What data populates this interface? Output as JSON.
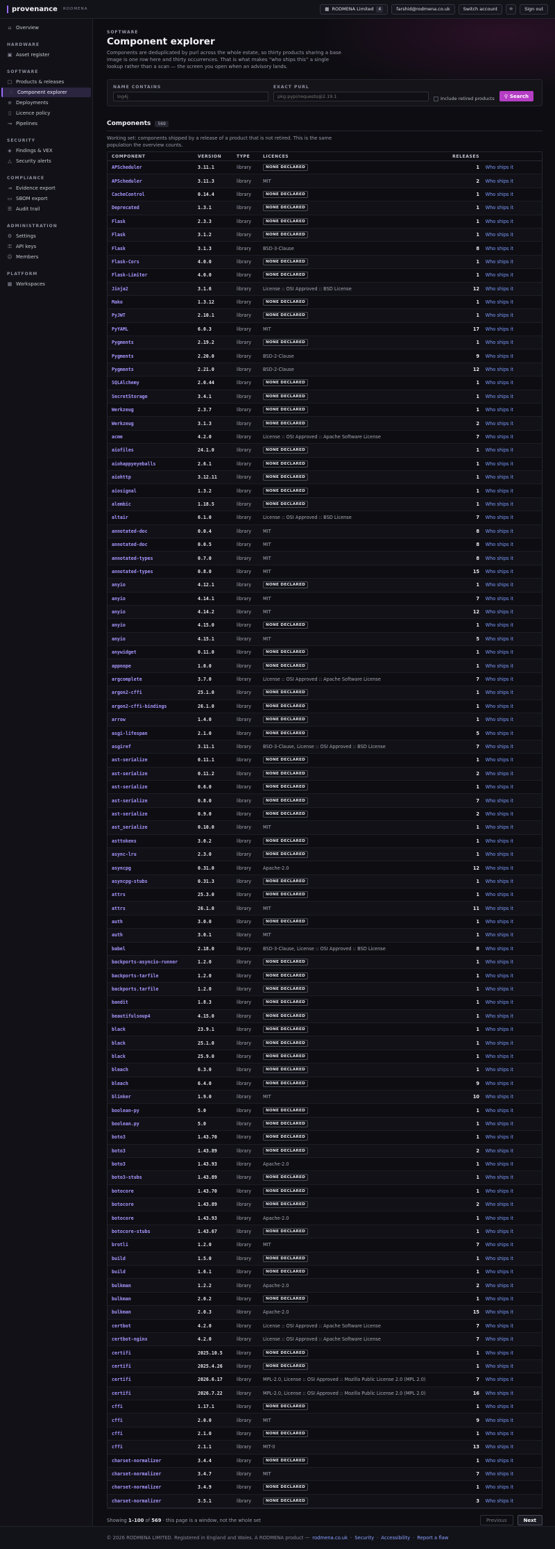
{
  "header": {
    "brand": "provenance",
    "brand_sub": "RODMENA",
    "org_name": "RODMENA Limited",
    "org_count": "4",
    "email": "farshid@rodmena.co.uk",
    "switch_label": "Switch account",
    "settings_icon": "sun-icon",
    "signout_label": "Sign out"
  },
  "sidebar": {
    "top": [
      {
        "label": "Overview",
        "icon": "home-icon"
      }
    ],
    "groups": [
      {
        "heading": "HARDWARE",
        "items": [
          {
            "label": "Asset register",
            "icon": "chip-icon"
          }
        ]
      },
      {
        "heading": "SOFTWARE",
        "items": [
          {
            "label": "Products & releases",
            "icon": "box-icon"
          },
          {
            "label": "Component explorer",
            "icon": "tree-icon",
            "active": true
          },
          {
            "label": "Deployments",
            "icon": "server-icon"
          },
          {
            "label": "Licence policy",
            "icon": "doc-icon"
          },
          {
            "label": "Pipelines",
            "icon": "pipeline-icon"
          }
        ]
      },
      {
        "heading": "SECURITY",
        "items": [
          {
            "label": "Findings & VEX",
            "icon": "shield-icon"
          },
          {
            "label": "Security alerts",
            "icon": "alert-icon"
          }
        ]
      },
      {
        "heading": "COMPLIANCE",
        "items": [
          {
            "label": "Evidence export",
            "icon": "export-icon"
          },
          {
            "label": "SBOM export",
            "icon": "file-icon"
          },
          {
            "label": "Audit trail",
            "icon": "list-icon"
          }
        ]
      },
      {
        "heading": "ADMINISTRATION",
        "items": [
          {
            "label": "Settings",
            "icon": "gear-icon"
          },
          {
            "label": "API keys",
            "icon": "key-icon"
          },
          {
            "label": "Members",
            "icon": "users-icon"
          }
        ]
      },
      {
        "heading": "PLATFORM",
        "items": [
          {
            "label": "Workspaces",
            "icon": "grid-icon"
          }
        ]
      }
    ]
  },
  "page": {
    "eyebrow": "SOFTWARE",
    "title": "Component explorer",
    "intro": "Components are deduplicated by purl across the whole estate, so thirty products sharing a base image is one row here and thirty occurrences. That is what makes “who ships this” a single lookup rather than a scan — the screen you open when an advisory lands."
  },
  "filters": {
    "name_label": "NAME CONTAINS",
    "name_placeholder": "log4j",
    "purl_label": "EXACT PURL",
    "purl_placeholder": "pkg:pypi/requests@2.19.1",
    "retired_label": "Include retired products",
    "search_label": "Search"
  },
  "components": {
    "title": "Components",
    "count": "569",
    "working_set": "Working set: components shipped by a release of a product that is not retired. This is the same population the overview counts.",
    "columns": [
      "COMPONENT",
      "VERSION",
      "TYPE",
      "LICENCES",
      "RELEASES",
      ""
    ],
    "none_declared": "NONE DECLARED",
    "action_label": "Who ships it",
    "rows": [
      [
        "APScheduler",
        "3.11.1",
        "library",
        "",
        1
      ],
      [
        "APScheduler",
        "3.11.3",
        "library",
        "MIT",
        2
      ],
      [
        "CacheControl",
        "0.14.4",
        "library",
        "",
        1
      ],
      [
        "Deprecated",
        "1.3.1",
        "library",
        "",
        1
      ],
      [
        "Flask",
        "2.3.3",
        "library",
        "",
        1
      ],
      [
        "Flask",
        "3.1.2",
        "library",
        "",
        1
      ],
      [
        "Flask",
        "3.1.3",
        "library",
        "BSD-3-Clause",
        8
      ],
      [
        "Flask-Cors",
        "4.0.0",
        "library",
        "",
        1
      ],
      [
        "Flask-Limiter",
        "4.0.0",
        "library",
        "",
        1
      ],
      [
        "Jinja2",
        "3.1.6",
        "library",
        "License :: OSI Approved :: BSD License",
        12
      ],
      [
        "Mako",
        "1.3.12",
        "library",
        "",
        1
      ],
      [
        "PyJWT",
        "2.10.1",
        "library",
        "",
        1
      ],
      [
        "PyYAML",
        "6.0.3",
        "library",
        "MIT",
        17
      ],
      [
        "Pygments",
        "2.19.2",
        "library",
        "",
        1
      ],
      [
        "Pygments",
        "2.20.0",
        "library",
        "BSD-2-Clause",
        9
      ],
      [
        "Pygments",
        "2.21.0",
        "library",
        "BSD-2-Clause",
        12
      ],
      [
        "SQLAlchemy",
        "2.0.44",
        "library",
        "",
        1
      ],
      [
        "SecretStorage",
        "3.4.1",
        "library",
        "",
        1
      ],
      [
        "Werkzeug",
        "2.3.7",
        "library",
        "",
        1
      ],
      [
        "Werkzeug",
        "3.1.3",
        "library",
        "",
        2
      ],
      [
        "acme",
        "4.2.0",
        "library",
        "License :: OSI Approved :: Apache Software License",
        7
      ],
      [
        "aiofiles",
        "24.1.0",
        "library",
        "",
        1
      ],
      [
        "aiohappyeyeballs",
        "2.6.1",
        "library",
        "",
        1
      ],
      [
        "aiohttp",
        "3.12.11",
        "library",
        "",
        1
      ],
      [
        "aiosignal",
        "1.3.2",
        "library",
        "",
        1
      ],
      [
        "alembic",
        "1.18.5",
        "library",
        "",
        1
      ],
      [
        "altair",
        "6.1.0",
        "library",
        "License :: OSI Approved :: BSD License",
        7
      ],
      [
        "annotated-doc",
        "0.0.4",
        "library",
        "MIT",
        8
      ],
      [
        "annotated-doc",
        "0.0.5",
        "library",
        "MIT",
        8
      ],
      [
        "annotated-types",
        "0.7.0",
        "library",
        "MIT",
        8
      ],
      [
        "annotated-types",
        "0.8.0",
        "library",
        "MIT",
        15
      ],
      [
        "anyio",
        "4.12.1",
        "library",
        "",
        1
      ],
      [
        "anyio",
        "4.14.1",
        "library",
        "MIT",
        7
      ],
      [
        "anyio",
        "4.14.2",
        "library",
        "MIT",
        12
      ],
      [
        "anyio",
        "4.15.0",
        "library",
        "",
        1
      ],
      [
        "anyio",
        "4.15.1",
        "library",
        "MIT",
        5
      ],
      [
        "anywidget",
        "0.11.0",
        "library",
        "",
        1
      ],
      [
        "appnope",
        "1.0.0",
        "library",
        "",
        1
      ],
      [
        "argcomplete",
        "3.7.0",
        "library",
        "License :: OSI Approved :: Apache Software License",
        7
      ],
      [
        "argon2-cffi",
        "25.1.0",
        "library",
        "",
        1
      ],
      [
        "argon2-cffi-bindings",
        "26.1.0",
        "library",
        "",
        1
      ],
      [
        "arrow",
        "1.4.0",
        "library",
        "",
        1
      ],
      [
        "asgi-lifespan",
        "2.1.0",
        "library",
        "",
        5
      ],
      [
        "asgiref",
        "3.11.1",
        "library",
        "BSD-3-Clause, License :: OSI Approved :: BSD License",
        7
      ],
      [
        "ast-serialize",
        "0.11.1",
        "library",
        "",
        1
      ],
      [
        "ast-serialize",
        "0.11.2",
        "library",
        "",
        2
      ],
      [
        "ast-serialize",
        "0.6.0",
        "library",
        "",
        1
      ],
      [
        "ast-serialize",
        "0.8.0",
        "library",
        "",
        7
      ],
      [
        "ast-serialize",
        "0.9.0",
        "library",
        "",
        2
      ],
      [
        "ast_serialize",
        "0.10.0",
        "library",
        "MIT",
        1
      ],
      [
        "asttokens",
        "3.0.2",
        "library",
        "",
        1
      ],
      [
        "async-lru",
        "2.3.0",
        "library",
        "",
        1
      ],
      [
        "asyncpg",
        "0.31.0",
        "library",
        "Apache-2.0",
        12
      ],
      [
        "asyncpg-stubs",
        "0.31.3",
        "library",
        "",
        1
      ],
      [
        "attrs",
        "25.3.0",
        "library",
        "",
        1
      ],
      [
        "attrs",
        "26.1.0",
        "library",
        "MIT",
        11
      ],
      [
        "auth",
        "3.0.0",
        "library",
        "",
        1
      ],
      [
        "auth",
        "3.0.1",
        "library",
        "MIT",
        1
      ],
      [
        "babel",
        "2.18.0",
        "library",
        "BSD-3-Clause, License :: OSI Approved :: BSD License",
        8
      ],
      [
        "backports-asyncio-runner",
        "1.2.0",
        "library",
        "",
        1
      ],
      [
        "backports-tarfile",
        "1.2.0",
        "library",
        "",
        1
      ],
      [
        "backports.tarfile",
        "1.2.0",
        "library",
        "",
        1
      ],
      [
        "bandit",
        "1.8.3",
        "library",
        "",
        1
      ],
      [
        "beautifulsoup4",
        "4.15.0",
        "library",
        "",
        1
      ],
      [
        "black",
        "23.9.1",
        "library",
        "",
        1
      ],
      [
        "black",
        "25.1.0",
        "library",
        "",
        1
      ],
      [
        "black",
        "25.9.0",
        "library",
        "",
        1
      ],
      [
        "bleach",
        "6.3.0",
        "library",
        "",
        1
      ],
      [
        "bleach",
        "6.4.0",
        "library",
        "",
        9
      ],
      [
        "blinker",
        "1.9.0",
        "library",
        "MIT",
        10
      ],
      [
        "boolean-py",
        "5.0",
        "library",
        "",
        1
      ],
      [
        "boolean.py",
        "5.0",
        "library",
        "",
        1
      ],
      [
        "boto3",
        "1.43.70",
        "library",
        "",
        1
      ],
      [
        "boto3",
        "1.43.89",
        "library",
        "",
        2
      ],
      [
        "boto3",
        "1.43.93",
        "library",
        "Apache-2.0",
        1
      ],
      [
        "boto3-stubs",
        "1.43.89",
        "library",
        "",
        1
      ],
      [
        "botocore",
        "1.43.70",
        "library",
        "",
        1
      ],
      [
        "botocore",
        "1.43.89",
        "library",
        "",
        2
      ],
      [
        "botocore",
        "1.43.93",
        "library",
        "Apache-2.0",
        1
      ],
      [
        "botocore-stubs",
        "1.43.67",
        "library",
        "",
        1
      ],
      [
        "brotli",
        "1.2.0",
        "library",
        "MIT",
        7
      ],
      [
        "build",
        "1.5.0",
        "library",
        "",
        1
      ],
      [
        "build",
        "1.6.1",
        "library",
        "",
        1
      ],
      [
        "bulkman",
        "1.2.2",
        "library",
        "Apache-2.0",
        2
      ],
      [
        "bulkman",
        "2.0.2",
        "library",
        "",
        1
      ],
      [
        "bulkman",
        "2.0.3",
        "library",
        "Apache-2.0",
        15
      ],
      [
        "certbot",
        "4.2.0",
        "library",
        "License :: OSI Approved :: Apache Software License",
        7
      ],
      [
        "certbot-nginx",
        "4.2.0",
        "library",
        "License :: OSI Approved :: Apache Software License",
        7
      ],
      [
        "certifi",
        "2025.10.5",
        "library",
        "",
        1
      ],
      [
        "certifi",
        "2025.4.26",
        "library",
        "",
        1
      ],
      [
        "certifi",
        "2026.6.17",
        "library",
        "MPL-2.0, License :: OSI Approved :: Mozilla Public License 2.0 (MPL 2.0)",
        7
      ],
      [
        "certifi",
        "2026.7.22",
        "library",
        "MPL-2.0, License :: OSI Approved :: Mozilla Public License 2.0 (MPL 2.0)",
        16
      ],
      [
        "cffi",
        "1.17.1",
        "library",
        "",
        1
      ],
      [
        "cffi",
        "2.0.0",
        "library",
        "MIT",
        9
      ],
      [
        "cffi",
        "2.1.0",
        "library",
        "",
        1
      ],
      [
        "cffi",
        "2.1.1",
        "library",
        "MIT-0",
        13
      ],
      [
        "charset-normalizer",
        "3.4.4",
        "library",
        "",
        1
      ],
      [
        "charset-normalizer",
        "3.4.7",
        "library",
        "MIT",
        7
      ],
      [
        "charset-normalizer",
        "3.4.9",
        "library",
        "",
        1
      ],
      [
        "charset-normalizer",
        "3.5.1",
        "library",
        "",
        3
      ]
    ]
  },
  "pager": {
    "prefix": "Showing",
    "range": "1–100",
    "of": "of",
    "total": "569",
    "suffix": "· this page is a window, not the whole set",
    "prev": "Previous",
    "next": "Next"
  },
  "footer": {
    "text": "© 2026 RODMENA LIMITED. Registered in England and Wales. A RODMENA product —",
    "link1": "rodmena.co.uk",
    "link2": "Security",
    "link3": "Accessibility",
    "link4": "Report a flaw",
    "sep": "·"
  }
}
